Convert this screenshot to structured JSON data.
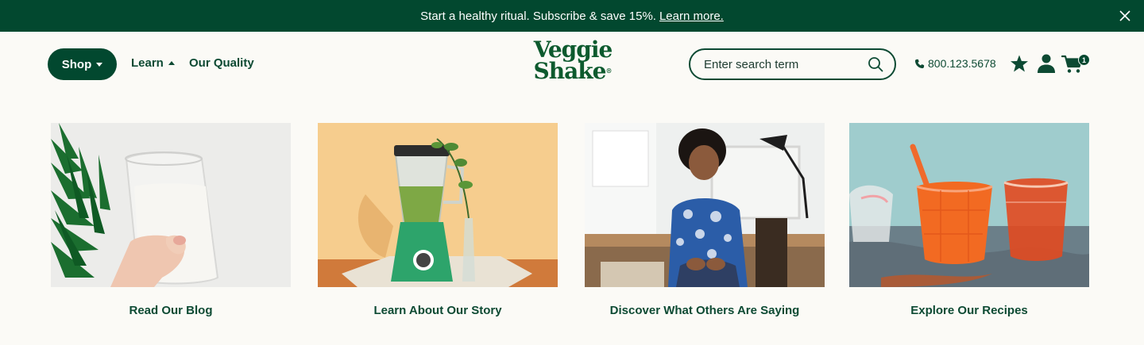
{
  "promo": {
    "text": "Start a healthy ritual. Subscribe & save 15%.",
    "link": "Learn more."
  },
  "nav": {
    "shop": "Shop",
    "learn": "Learn",
    "quality": "Our Quality"
  },
  "logo": {
    "line1": "Veggie",
    "line2": "Shake",
    "mark": "®"
  },
  "search": {
    "placeholder": "Enter search term"
  },
  "phone": "800.123.5678",
  "cart": {
    "count": "1"
  },
  "cards": [
    {
      "label": "Read Our Blog"
    },
    {
      "label": "Learn About Our Story"
    },
    {
      "label": "Discover What Others Are Saying"
    },
    {
      "label": "Explore Our Recipes"
    }
  ],
  "colors": {
    "brand_green": "#02482f",
    "text_green": "#0d4a33",
    "background": "#fbfaf6"
  }
}
